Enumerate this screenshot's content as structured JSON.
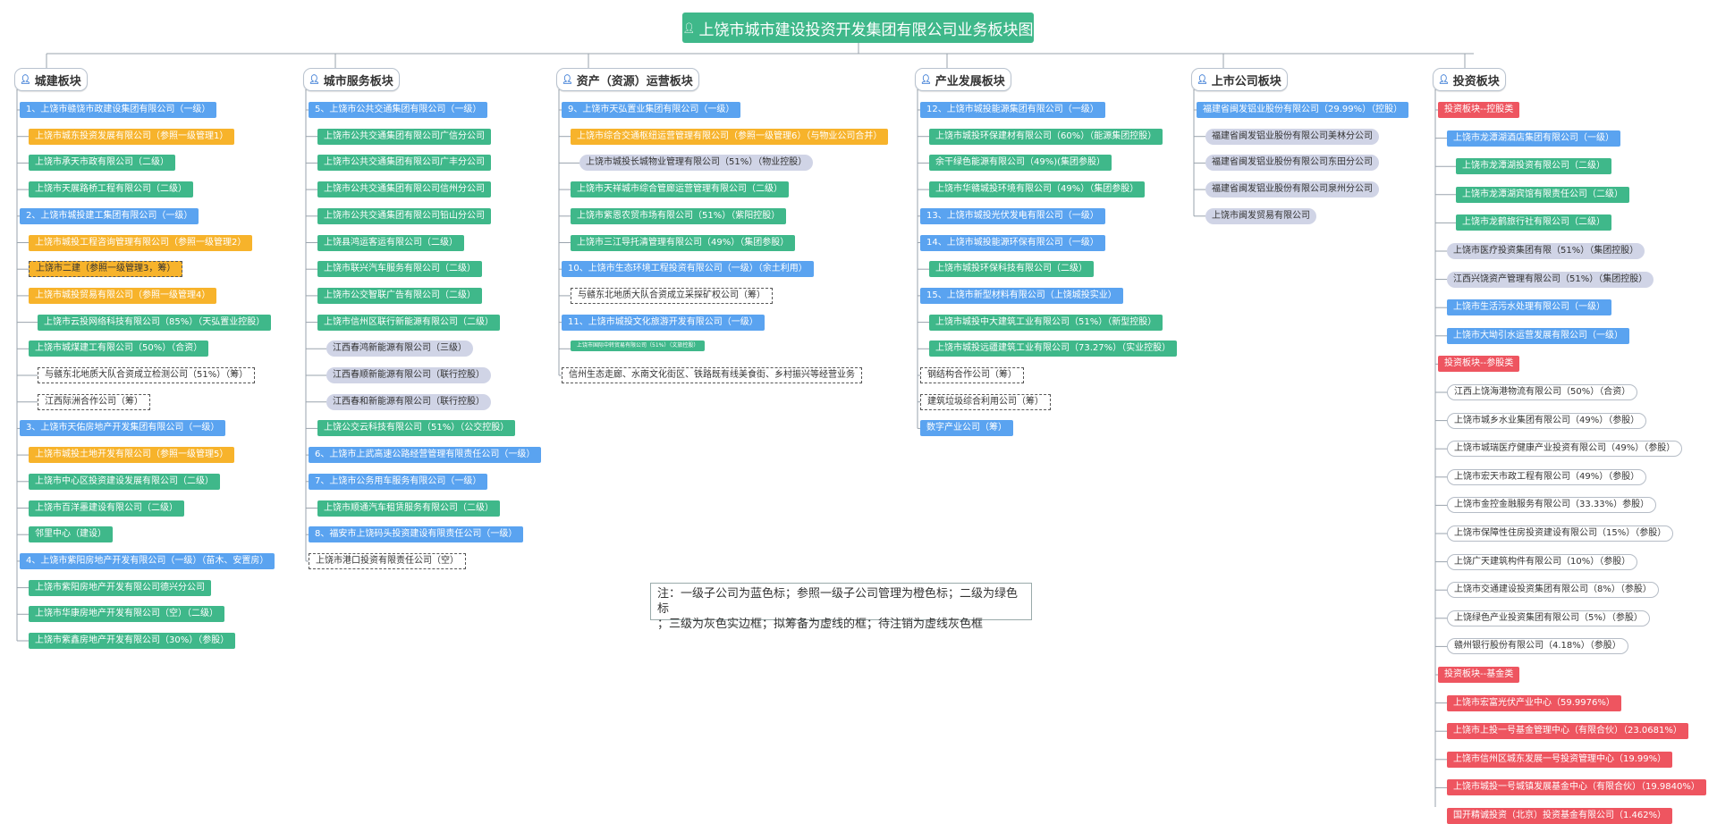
{
  "root": {
    "title": "上饶市城市建设投资开发集团有限公司业务板块图",
    "icon": "person-icon"
  },
  "note": {
    "line1": "注：一级子公司为蓝色标；参照一级子公司管理为橙色标；二级为绿色标",
    "line2": "；三级为灰色实边框；拟筹备为虚线的框；待注销为虚线灰色框"
  },
  "colors": {
    "blue": "#5aa3f0",
    "orange": "#f7b32b",
    "green": "#3fb88a",
    "red": "#ee5560",
    "gray": "#b5bcc6",
    "lavender": "#d0d4e6"
  },
  "sections": [
    {
      "title": "城建板块",
      "nodes": [
        {
          "t": "1、上饶市赣饶市政建设集团有限公司（一级）",
          "s": "blue",
          "l": 0
        },
        {
          "t": "上饶市城东投资发展有限公司（参照一级管理1）",
          "s": "orange",
          "l": 1
        },
        {
          "t": "上饶市承天市政有限公司（二级）",
          "s": "green",
          "l": 1
        },
        {
          "t": "上饶市天展路桥工程有限公司（二级）",
          "s": "green",
          "l": 1
        },
        {
          "t": "2、上饶市城投建工集团有限公司（一级）",
          "s": "blue",
          "l": 0
        },
        {
          "t": "上饶市城投工程咨询管理有限公司（参照一级管理2）",
          "s": "orange",
          "l": 1
        },
        {
          "t": "上饶市二建（参照一级管理3，筹）",
          "s": "odash",
          "l": 1
        },
        {
          "t": "上饶市城投贸易有限公司（参照一级管理4）",
          "s": "orange",
          "l": 1
        },
        {
          "t": "上饶市云投网络科技有限公司（85%）（天弘置业控股）",
          "s": "green",
          "l": 2
        },
        {
          "t": "上饶市城煤建工有限公司（50%）（合资）",
          "s": "green",
          "l": 1
        },
        {
          "t": "与赣东北地质大队合资成立检测公司（51%）（筹）",
          "s": "dash",
          "l": 2
        },
        {
          "t": "江西际洲合作公司（筹）",
          "s": "dash",
          "l": 2
        },
        {
          "t": "3、上饶市天佑房地产开发集团有限公司（一级）",
          "s": "blue",
          "l": 0
        },
        {
          "t": "上饶市城投土地开发有限公司（参照一级管理5）",
          "s": "orange",
          "l": 1
        },
        {
          "t": "上饶市中心区投资建设发展有限公司（二级）",
          "s": "green",
          "l": 1
        },
        {
          "t": "上饶市百洋墨建设有限公司（二级）",
          "s": "green",
          "l": 1
        },
        {
          "t": "邻里中心（建设）",
          "s": "green",
          "l": 1
        },
        {
          "t": "4、上饶市紫阳房地产开发有限公司（一级）（苗木、安置房）",
          "s": "blue",
          "l": 0
        },
        {
          "t": "上饶市紫阳房地产开发有限公司德兴分公司",
          "s": "green",
          "l": 1
        },
        {
          "t": "上饶市华康房地产开发有限公司（空）（二级）",
          "s": "green",
          "l": 1
        },
        {
          "t": "上饶市紫鑫房地产开发有限公司（30%）（参股）",
          "s": "green",
          "l": 1
        }
      ]
    },
    {
      "title": "城市服务板块",
      "nodes": [
        {
          "t": "5、上饶市公共交通集团有限公司（一级）",
          "s": "blue",
          "l": 0
        },
        {
          "t": "上饶市公共交通集团有限公司广信分公司",
          "s": "green",
          "l": 1
        },
        {
          "t": "上饶市公共交通集团有限公司广丰分公司",
          "s": "green",
          "l": 1
        },
        {
          "t": "上饶市公共交通集团有限公司信州分公司",
          "s": "green",
          "l": 1
        },
        {
          "t": "上饶市公共交通集团有限公司铅山分公司",
          "s": "green",
          "l": 1
        },
        {
          "t": "上饶县鸿运客运有限公司（二级）",
          "s": "green",
          "l": 1
        },
        {
          "t": "上饶市联兴汽车服务有限公司（二级）",
          "s": "green",
          "l": 1
        },
        {
          "t": "上饶市公交智联广告有限公司（二级）",
          "s": "green",
          "l": 1
        },
        {
          "t": "上饶市信州区联行新能源有限公司（二级）",
          "s": "green",
          "l": 1
        },
        {
          "t": "江西春鸿新能源有限公司（三级）",
          "s": "lgray",
          "l": 2
        },
        {
          "t": "江西春顺新能源有限公司（联行控股）",
          "s": "lgray",
          "l": 2
        },
        {
          "t": "江西春和新能源有限公司（联行控股）",
          "s": "lgray",
          "l": 2
        },
        {
          "t": "上饶公交云科技有限公司（51%）（公交控股）",
          "s": "green",
          "l": 1
        },
        {
          "t": "6、上饶市上武高速公路经营管理有限责任公司（一级）",
          "s": "blue",
          "l": 0
        },
        {
          "t": "7、上饶市公务用车服务有限公司（一级）",
          "s": "blue",
          "l": 0
        },
        {
          "t": "上饶市顺通汽车租赁服务有限公司（二级）",
          "s": "green",
          "l": 1
        },
        {
          "t": "8、福安市上饶码头投资建设有限责任公司（一级）",
          "s": "blue",
          "l": 0
        },
        {
          "t": "上饶市港口投资有限责任公司（空）",
          "s": "dash",
          "l": 0
        }
      ]
    },
    {
      "title": "资产（资源）运营板块",
      "nodes": [
        {
          "t": "9、上饶市天弘置业集团有限公司（一级）",
          "s": "blue",
          "l": 0
        },
        {
          "t": "上饶市综合交通枢纽运营管理有限公司（参照一级管理6）（与物业公司合并）",
          "s": "orange",
          "l": 1
        },
        {
          "t": "上饶市城投长城物业管理有限公司（51%）（物业控股）",
          "s": "lgray",
          "l": 2
        },
        {
          "t": "上饶市天祥城市综合管廊运营管理有限公司（二级）",
          "s": "green",
          "l": 1
        },
        {
          "t": "上饶市紫恩农贸市场有限公司（51%）（紫阳控股）",
          "s": "green",
          "l": 1
        },
        {
          "t": "上饶市三江导托清管理有限公司（49%）（集团参股）",
          "s": "green",
          "l": 1
        },
        {
          "t": "10、上饶市生态环境工程投资有限公司（一级）（余土利用）",
          "s": "blue",
          "l": 0
        },
        {
          "t": "与赣东北地质大队合资成立采探矿权公司（筹）",
          "s": "dash",
          "l": 1
        },
        {
          "t": "11、上饶市城投文化旅游开发有限公司（一级）",
          "s": "blue",
          "l": 0
        },
        {
          "t": "上饶市国际中转贸易有限公司（51%）（文旅控股）",
          "s": "green",
          "l": 1,
          "tiny": true
        },
        {
          "t": "信州生态走廊、水南文化街区、铁路既有线美食街、乡村振兴等经营业务",
          "s": "dash",
          "l": 0
        }
      ]
    },
    {
      "title": "产业发展板块",
      "nodes": [
        {
          "t": "12、上饶市城投能源集团有限公司（一级）",
          "s": "blue",
          "l": 0
        },
        {
          "t": "上饶市城投环保建材有限公司（60%）（能源集团控股）",
          "s": "green",
          "l": 1
        },
        {
          "t": "余干绿色能源有限公司（49%)(集团参股）",
          "s": "green",
          "l": 1
        },
        {
          "t": "上饶市华赣城投环境有限公司（49%）（集团参股）",
          "s": "green",
          "l": 1
        },
        {
          "t": "13、上饶市城投光伏发电有限公司（一级）",
          "s": "blue",
          "l": 0
        },
        {
          "t": "14、上饶市城投能源环保有限公司（一级）",
          "s": "blue",
          "l": 0
        },
        {
          "t": "上饶市城投环保科技有限公司（二级）",
          "s": "green",
          "l": 1
        },
        {
          "t": "15、上饶市新型材料有限公司（上饶城投实业）",
          "s": "blue",
          "l": 0
        },
        {
          "t": "上饶市城投中大建筑工业有限公司（51%）（新型控股）",
          "s": "green",
          "l": 1
        },
        {
          "t": "上饶市城投远疆建筑工业有限公司（73.27%）（实业控股）",
          "s": "green",
          "l": 1
        },
        {
          "t": "钢结构合作公司（筹）",
          "s": "dash",
          "l": 0
        },
        {
          "t": "建筑垃圾综合利用公司（筹）",
          "s": "dash",
          "l": 0
        },
        {
          "t": "数字产业公司（筹）",
          "s": "blue",
          "l": 0
        }
      ]
    },
    {
      "title": "上市公司板块",
      "nodes": [
        {
          "t": "福建省闽发铝业股份有限公司（29.99%）（控股）",
          "s": "blue",
          "l": 0
        },
        {
          "t": "福建省闽发铝业股份有限公司美林分公司",
          "s": "lgray",
          "l": 1
        },
        {
          "t": "福建省闽发铝业股份有限公司东田分公司",
          "s": "lgray",
          "l": 1
        },
        {
          "t": "福建省闽发铝业股份有限公司泉州分公司",
          "s": "lgray",
          "l": 1
        },
        {
          "t": "上饶市闽发贸易有限公司",
          "s": "lgray",
          "l": 1
        }
      ]
    },
    {
      "title": "投资板块",
      "nodes": [
        {
          "t": "投资板块--控股类",
          "s": "red",
          "l": 0
        },
        {
          "t": "上饶市龙潭湖酒店集团有限公司（一级）",
          "s": "blue",
          "l": 1
        },
        {
          "t": "上饶市龙潭湖投资有限公司（二级）",
          "s": "green",
          "l": 2
        },
        {
          "t": "上饶市龙潭湖宾馆有限责任公司（二级）",
          "s": "green",
          "l": 2
        },
        {
          "t": "上饶市龙鹤旅行社有限公司（二级）",
          "s": "green",
          "l": 2
        },
        {
          "t": "上饶市医疗投资集团有限（51%）（集团控股）",
          "s": "lgray",
          "l": 1
        },
        {
          "t": "江西兴饶资产管理有限公司（51%）（集团控股）",
          "s": "lgray",
          "l": 1
        },
        {
          "t": "上饶市生活污水处理有限公司（一级）",
          "s": "blue",
          "l": 1
        },
        {
          "t": "上饶市大坳引水运营发展有限公司（一级）",
          "s": "blue",
          "l": 1
        },
        {
          "t": "投资板块--参股类",
          "s": "red",
          "l": 0
        },
        {
          "t": "江西上饶海港物流有限公司（50%）（合资）",
          "s": "gray",
          "l": 1
        },
        {
          "t": "上饶市城乡水业集团有限公司（49%）（参股）",
          "s": "gray",
          "l": 1
        },
        {
          "t": "上饶市城瑞医疗健康产业投资有限公司（49%）（参股）",
          "s": "gray",
          "l": 1
        },
        {
          "t": "上饶市宏天市政工程有限公司（49%）（参股）",
          "s": "gray",
          "l": 1
        },
        {
          "t": "上饶市金控金融服务有限公司（33.33%）参股）",
          "s": "gray",
          "l": 1
        },
        {
          "t": "上饶市保障性住房投资建设有限公司（15%）（参股）",
          "s": "gray",
          "l": 1
        },
        {
          "t": "上饶广天建筑构件有限公司（10%）（参股）",
          "s": "gray",
          "l": 1
        },
        {
          "t": "上饶市交通建设投资集团有限公司（8%）（参股）",
          "s": "gray",
          "l": 1
        },
        {
          "t": "上饶绿色产业投资集团有限公司（5%）（参股）",
          "s": "gray",
          "l": 1
        },
        {
          "t": "赣州银行股份有限公司（4.18%）（参股）",
          "s": "gray",
          "l": 1
        },
        {
          "t": "投资板块--基金类",
          "s": "red",
          "l": 0
        },
        {
          "t": "上饶市宏富光伏产业中心（59.9976%）",
          "s": "red",
          "l": 1
        },
        {
          "t": "上饶市上投一号基金管理中心（有限合伙）（23.0681%）",
          "s": "red",
          "l": 1
        },
        {
          "t": "上饶市信州区城东发展一号投资管理中心（19.99%）",
          "s": "red",
          "l": 1
        },
        {
          "t": "上饶市城投一号城镇发展基金中心（有限合伙）（19.9840%）",
          "s": "red",
          "l": 1
        },
        {
          "t": "国开精诚投资（北京）投资基金有限公司（1.462%）",
          "s": "red",
          "l": 1
        }
      ]
    }
  ]
}
